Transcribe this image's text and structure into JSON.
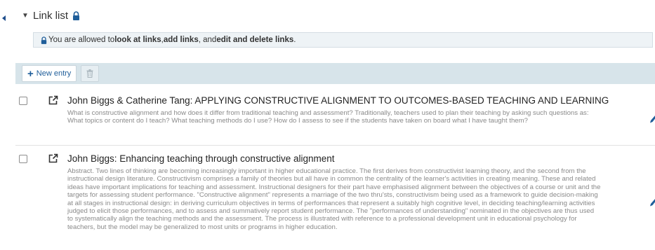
{
  "section": {
    "title": "Link list",
    "collapsed_indicator": "▼"
  },
  "notice": {
    "prefix": "You are allowed to ",
    "perm1": "look at links",
    "sep1": ", ",
    "perm2": "add links",
    "sep2": ", and ",
    "perm3": "edit and delete links",
    "suffix": "."
  },
  "toolbar": {
    "new_entry_label": "New entry"
  },
  "entries": [
    {
      "title": "John Biggs & Catherine Tang: APPLYING CONSTRUCTIVE ALIGNMENT TO OUTCOMES-BASED TEACHING AND LEARNING",
      "description": "What is constructive alignment and how does it differ from traditional teaching and assessment? Traditionally, teachers used to plan their teaching by asking such questions as: What topics or content do I teach? What teaching methods do I use? How do I assess to see if the students have taken on board what I have taught them?"
    },
    {
      "title": "John Biggs: Enhancing teaching through constructive alignment",
      "description": "Abstract. Two lines of thinking are becoming increasingly important in higher educational practice. The first derives from constructivist learning theory, and the second from the instructional design literature. Constructivism comprises a family of theories but all have in common the centrality of the learner's activities in creating meaning. These and related ideas have important implications for teaching and assessment. Instructional designers for their part have emphasised alignment between the objectives of a course or unit and the targets for assessing student performance. \"Constructive alignment\" represents a marriage of the two thru'sts, constructivism being used as a framework to guide decision-making at all stages in instructional design: in deriving curriculum objectives in terms of performances that represent a suitably high cognitive level, in deciding teaching/learning activities judged to elicit those performances, and to assess and summatively report student performance. The \"performances of understanding\" nominated in the objectives are thus used to systematically align the teaching methods and the assessment. The process is illustrated with reference to a professional development unit in educational psychology for teachers, but the model may be generalized to most units or programs in higher education."
    }
  ],
  "colors": {
    "accent": "#1f5e9a",
    "toolbar_bg": "#d7e4ea",
    "notice_bg": "#eef3f6"
  }
}
